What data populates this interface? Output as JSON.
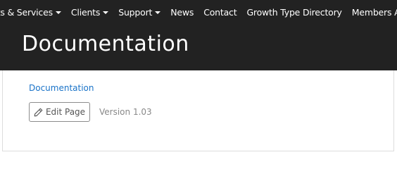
{
  "nav": {
    "items": [
      {
        "label": "cts & Services",
        "dropdown": true
      },
      {
        "label": "Clients",
        "dropdown": true
      },
      {
        "label": "Support",
        "dropdown": true
      },
      {
        "label": "News",
        "dropdown": false
      },
      {
        "label": "Contact",
        "dropdown": false
      },
      {
        "label": "Growth Type Directory",
        "dropdown": false
      },
      {
        "label": "Members Area",
        "dropdown": true
      }
    ]
  },
  "hero": {
    "title": "Documentation"
  },
  "content": {
    "breadcrumb": "Documentation",
    "edit_button": {
      "label": "Edit Page",
      "icon": "pencil-icon"
    },
    "version": "Version 1.03"
  },
  "colors": {
    "header_bg": "#222222",
    "link": "#1a73c8",
    "muted_text": "#888888"
  }
}
